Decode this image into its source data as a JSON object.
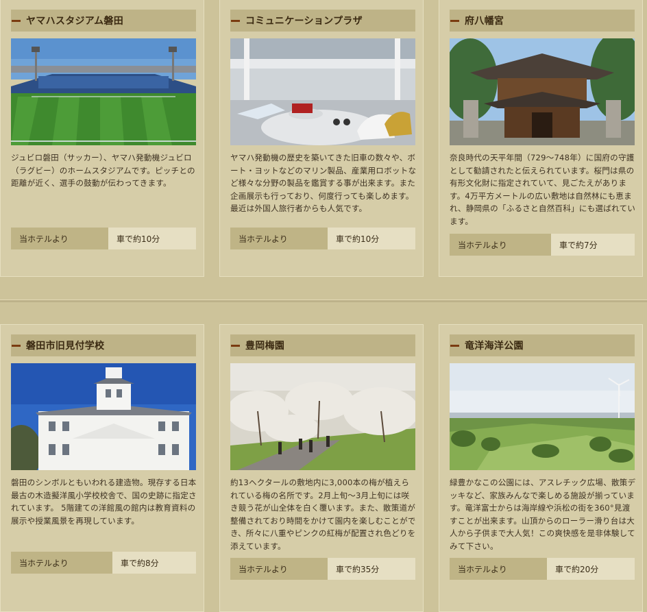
{
  "spots": [
    {
      "title": "ヤマハスタジアム磐田",
      "description": "ジュビロ磐田（サッカー）、ヤマハ発動機ジュビロ（ラグビー）のホームスタジアムです。ピッチとの距離が近く、選手の鼓動が伝わってきます。",
      "access_from": "当ホテルより",
      "access_time": "車で約10分",
      "image": "stadium-photo"
    },
    {
      "title": "コミュニケーションプラザ",
      "description": "ヤマハ発動機の歴史を築いてきた旧車の数々や、ボート・ヨットなどのマリン製品、産業用ロボットなど様々な分野の製品を鑑賞する事が出来ます。また企画展示も行っており、何度行っても楽しめます。最近は外国人旅行者からも人気です。",
      "access_from": "当ホテルより",
      "access_time": "車で約10分",
      "image": "museum-photo"
    },
    {
      "title": "府八幡宮",
      "description": "奈良時代の天平年間（729～748年）に国府の守護として勧請されたと伝えられています。桜門は県の有形文化財に指定されていて、見ごたえがあります。4万平方メートルの広い敷地は自然林にも恵まれ、静岡県の「ふるさと自然百科」にも選ばれています。",
      "access_from": "当ホテルより",
      "access_time": "車で約7分",
      "image": "shrine-photo"
    },
    {
      "title": "磐田市旧見付学校",
      "description": "磐田のシンボルともいわれる建造物。現存する日本最古の木造擬洋風小学校校舎で、国の史跡に指定されています。 5階建ての洋館風の館内は教育資料の展示や授業風景を再現しています。",
      "access_from": "当ホテルより",
      "access_time": "車で約8分",
      "image": "school-photo"
    },
    {
      "title": "豊岡梅園",
      "description": "約13ヘクタールの敷地内に3,000本の梅が植えられている梅の名所です。2月上旬～3月上旬には咲き競う花が山全体を白く覆います。また、散策道が整備されており時間をかけて園内を楽しむことができ、所々に八重やピンクの紅梅が配置され色どりを添えています。",
      "access_from": "当ホテルより",
      "access_time": "車で約35分",
      "image": "plum-garden-photo"
    },
    {
      "title": "竜洋海洋公園",
      "description": "緑豊かなこの公園には、アスレチック広場、散策デッキなど、家族みんなで楽しめる施設が揃っています。竜洋富士からは海岸線や浜松の街を360°見渡すことが出来ます。山頂からのローラー滑り台は大人から子供まで大人気！この爽快感を是非体験してみて下さい。",
      "access_from": "当ホテルより",
      "access_time": "車で約20分",
      "image": "park-photo"
    }
  ],
  "colors": {
    "background": "#cdc39a",
    "card": "#d6cda8",
    "header": "#beb387",
    "accent_bar": "#7a3b10"
  }
}
